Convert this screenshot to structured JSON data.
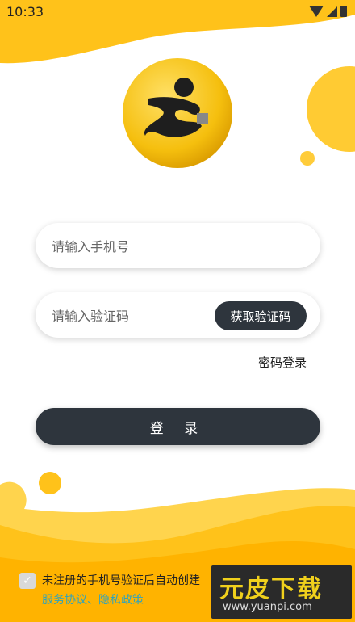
{
  "status_bar": {
    "time": "10:33"
  },
  "login": {
    "phone_placeholder": "请输入手机号",
    "code_placeholder": "请输入验证码",
    "get_code_label": "获取验证码",
    "password_login_label": "密码登录",
    "submit_label": "登 录"
  },
  "agreement": {
    "checkbox_mark": "✓",
    "text": "未注册的手机号验证后自动创建",
    "service_link": "服务协议",
    "separator": "、",
    "privacy_link": "隐私政策"
  },
  "watermark": {
    "title": "元皮下载",
    "url": "www.yuanpi.com"
  },
  "colors": {
    "accent_yellow": "#ffc21a",
    "button_dark": "#2e353d",
    "link": "#2fa3bd"
  }
}
